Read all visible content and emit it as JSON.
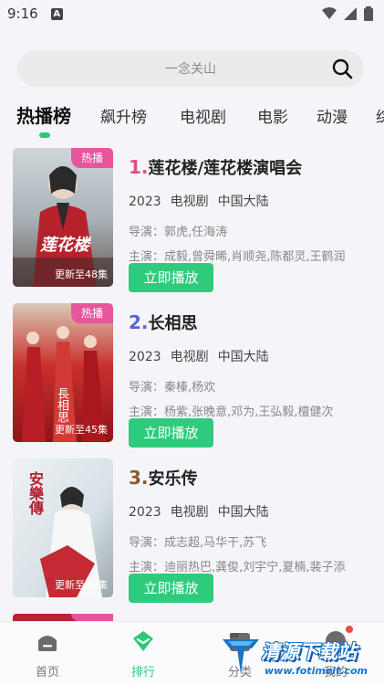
{
  "status_bar": {
    "time": "9:16",
    "notification_badge": "A"
  },
  "search": {
    "placeholder": "一念关山"
  },
  "tabs": [
    {
      "label": "热播榜",
      "active": true
    },
    {
      "label": "飙升榜"
    },
    {
      "label": "电视剧"
    },
    {
      "label": "电影"
    },
    {
      "label": "动漫"
    },
    {
      "label": "综"
    }
  ],
  "ranking": [
    {
      "rank": "1.",
      "rank_color": "#e24b8b",
      "title": "莲花楼/莲花楼演唱会",
      "year": "2023",
      "type": "电视剧",
      "region": "中国大陆",
      "director": "导演：郭虎,任海涛",
      "cast": "主演：成毅,曾舜晞,肖顺尧,陈都灵,王鹤润",
      "hot_badge": "热播",
      "update": "更新至48集",
      "poster_text": "莲花楼",
      "play_label": "立即播放"
    },
    {
      "rank": "2.",
      "rank_color": "#5865d8",
      "title": "长相思",
      "year": "2023",
      "type": "电视剧",
      "region": "中国大陆",
      "director": "导演：秦榛,杨欢",
      "cast": "主演：杨紫,张晚意,邓为,王弘毅,檀健次",
      "hot_badge": "热播",
      "update": "更新至45集",
      "poster_text": "長相思",
      "play_label": "立即播放"
    },
    {
      "rank": "3.",
      "rank_color": "#8a5a2e",
      "title": "安乐传",
      "year": "2023",
      "type": "电视剧",
      "region": "中国大陆",
      "director": "导演：成志超,马华干,苏飞",
      "cast": "主演：迪丽热巴,龚俊,刘宇宁,夏楠,裴子添",
      "hot_badge": "",
      "update": "更新至39集",
      "poster_text": "安樂傳",
      "play_label": "立即播放"
    }
  ],
  "bottom_nav": [
    {
      "label": "首页",
      "icon": "home-icon"
    },
    {
      "label": "排行",
      "icon": "ranking-icon",
      "active": true
    },
    {
      "label": "分类",
      "icon": "category-icon"
    },
    {
      "label": "我的",
      "icon": "profile-icon"
    }
  ],
  "watermark": {
    "brand": "清源下载站",
    "url": "www.fotimeit.com"
  },
  "colors": {
    "accent": "#2cc97a",
    "hot_badge": "#e8559d"
  }
}
